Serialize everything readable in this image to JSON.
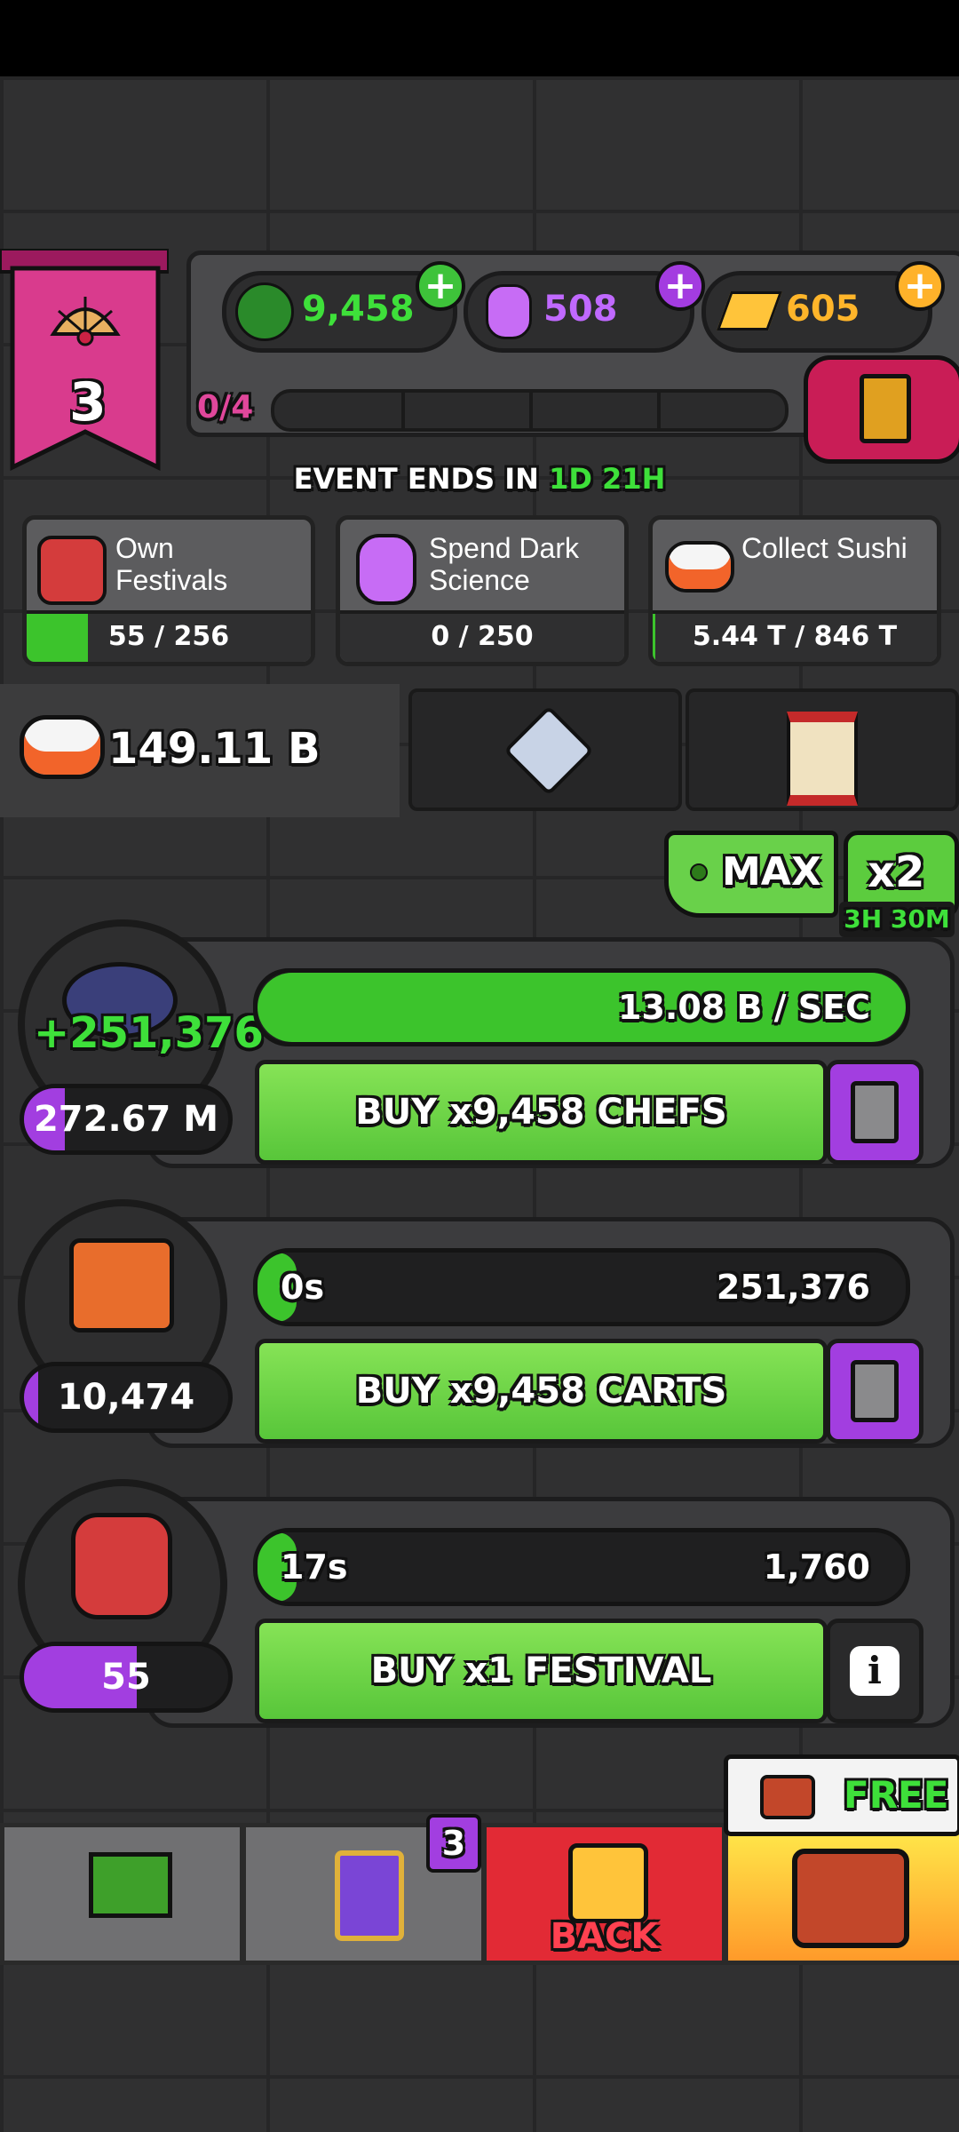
{
  "level": "3",
  "currencies": {
    "green": {
      "value": "9,458",
      "color": "#3ee03a"
    },
    "dark_science": {
      "value": "508",
      "color": "#c069ff"
    },
    "gold": {
      "value": "605",
      "color": "#ffb52a"
    }
  },
  "level_progress": "0/4",
  "event": {
    "prefix": "EVENT ENDS IN",
    "time": "1D 21H"
  },
  "tasks": [
    {
      "label": "Own Festivals",
      "progress": "55 / 256",
      "fraction": 0.215
    },
    {
      "label": "Spend Dark Science",
      "progress": "0 / 250",
      "fraction": 0
    },
    {
      "label": "Collect Sushi",
      "progress": "5.44 T / 846 T",
      "fraction": 0.006
    }
  ],
  "sushi_total": "149.11 B",
  "multiplier": {
    "max_label": "MAX",
    "boost_label": "x2",
    "boost_time": "3H 30M"
  },
  "rows": [
    {
      "float_text": "+251,376",
      "count": "272.67 M",
      "count_fill": 0.2,
      "bar_fill": 1.0,
      "bar_time": "",
      "bar_text": "13.08 B / SEC",
      "buy_label": "BUY x9,458 CHEFS"
    },
    {
      "float_text": "",
      "count": "10,474",
      "count_fill": 0.07,
      "bar_fill": 0.06,
      "bar_time": "0s",
      "bar_text": "251,376",
      "buy_label": "BUY x9,458 CARTS"
    },
    {
      "float_text": "",
      "count": "55",
      "count_fill": 0.55,
      "bar_fill": 0.06,
      "bar_time": "17s",
      "bar_text": "1,760",
      "buy_label": "BUY x1 FESTIVAL"
    }
  ],
  "nav": {
    "badge": "3",
    "back_label": "BACK",
    "free_label": "FREE"
  }
}
